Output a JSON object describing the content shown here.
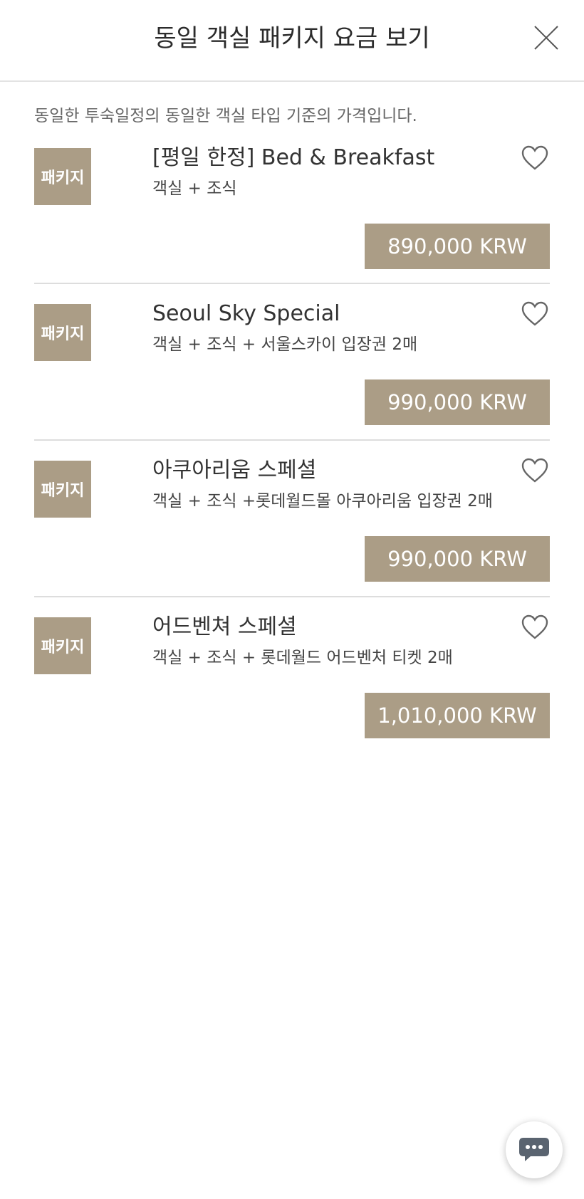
{
  "header": {
    "title": "동일 객실 패키지 요금 보기",
    "close_icon": "close-icon"
  },
  "notice": "동일한 투숙일정의 동일한 객실 타입 기준의 가격입니다.",
  "packages": [
    {
      "badge": "패키지",
      "title": "[평일 한정] Bed & Breakfast",
      "description": "객실 + 조식",
      "price": "890,000 KRW",
      "icon": "heart-outline-icon"
    },
    {
      "badge": "패키지",
      "title": "Seoul Sky Special",
      "description": "객실 + 조식 + 서울스카이 입장권 2매",
      "price": "990,000 KRW",
      "icon": "heart-outline-icon"
    },
    {
      "badge": "패키지",
      "title": "아쿠아리움 스페셜",
      "description": "객실 + 조식 +롯데월드몰 아쿠아리움 입장권 2매",
      "price": "990,000 KRW",
      "icon": "heart-outline-icon"
    },
    {
      "badge": "패키지",
      "title": "어드벤쳐 스페셜",
      "description": "객실 + 조식 + 롯데월드 어드벤처 티켓 2매",
      "price": "1,010,000 KRW",
      "icon": "heart-outline-icon"
    }
  ],
  "chat": {
    "icon": "chat-bubble-icon"
  },
  "colors": {
    "accent": "#ab9d86",
    "text": "#333333",
    "divider": "#dddddd"
  }
}
